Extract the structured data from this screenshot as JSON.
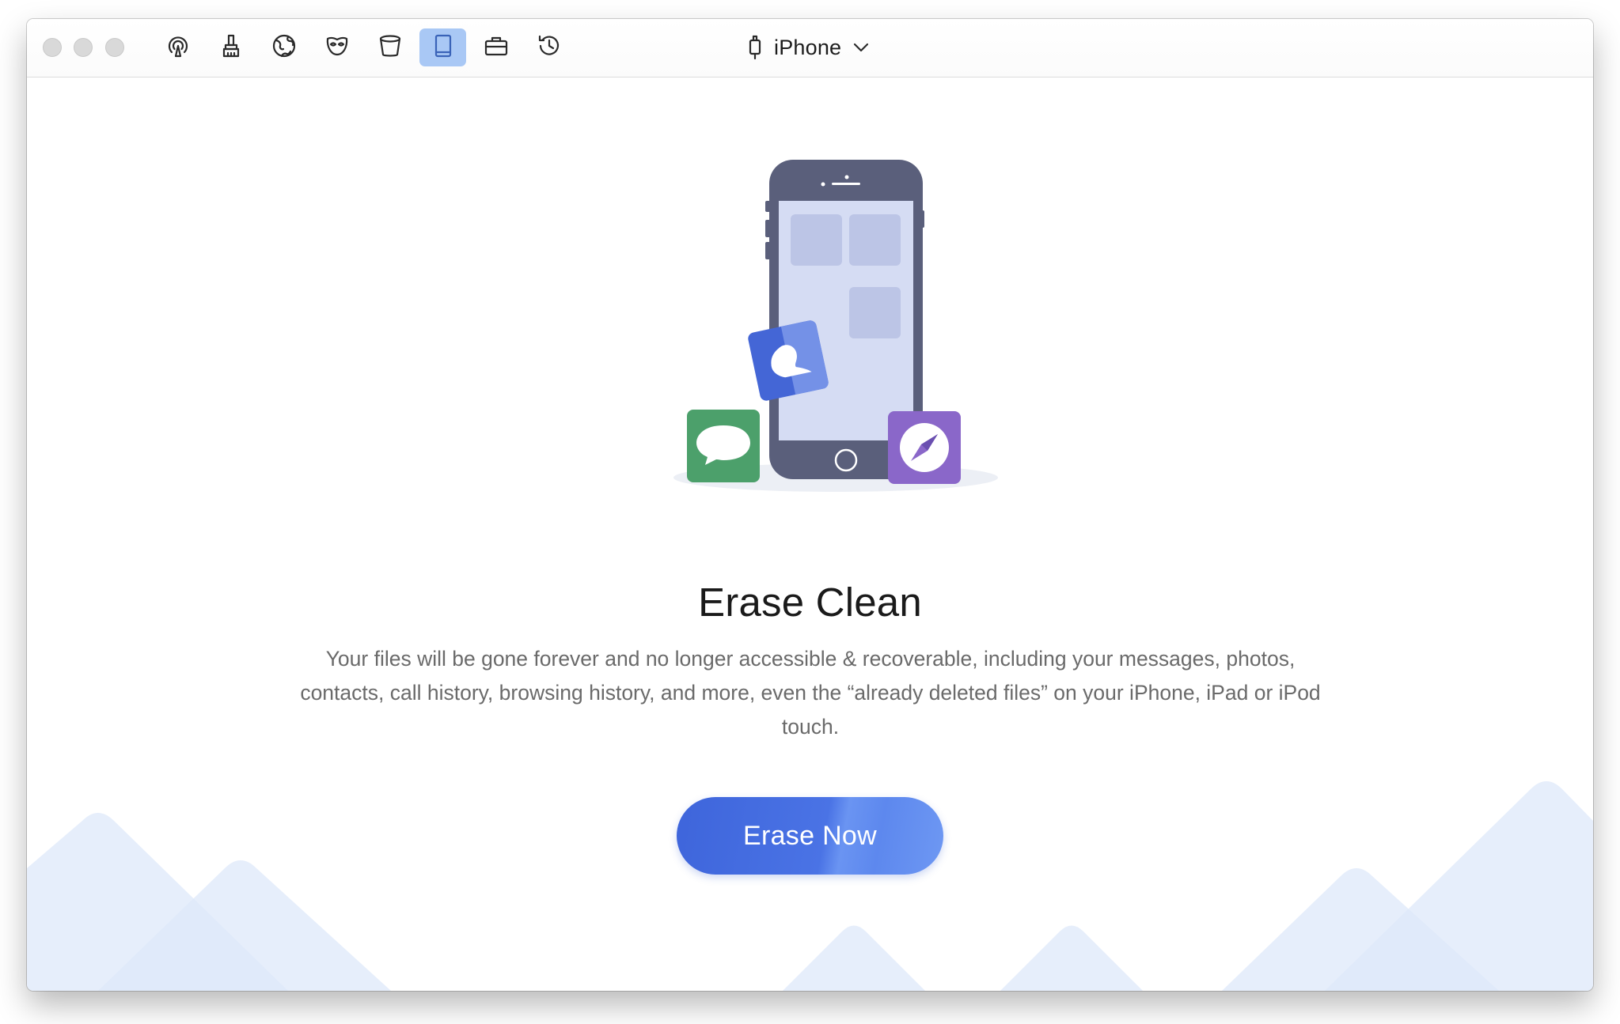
{
  "window": {
    "traffic_lights": [
      "close",
      "minimize",
      "zoom"
    ]
  },
  "toolbar": {
    "tools": [
      {
        "name": "airdrop-icon",
        "active": false
      },
      {
        "name": "brush-icon",
        "active": false
      },
      {
        "name": "globe-icon",
        "active": false
      },
      {
        "name": "mask-icon",
        "active": false
      },
      {
        "name": "trash-bin-icon",
        "active": false
      },
      {
        "name": "tablet-icon",
        "active": true
      },
      {
        "name": "briefcase-icon",
        "active": false
      },
      {
        "name": "history-clock-icon",
        "active": false
      }
    ],
    "device": {
      "icon": "device-connector-icon",
      "name": "iPhone",
      "chevron": "chevron-down-icon"
    }
  },
  "main": {
    "title": "Erase Clean",
    "description": "Your files will be gone forever and no longer accessible & recoverable, including your messages, photos, contacts, call history, browsing history, and more, even the “already deleted files” on your iPhone, iPad or iPod touch.",
    "button_label": "Erase Now"
  },
  "colors": {
    "accent": "#4a73e5",
    "active_tool_bg": "#a9c8f5",
    "mountain": "#dde8fa",
    "phone_body": "#5a5f7b",
    "phone_screen": "#d5dcf3",
    "messages_app": "#4ca06b",
    "safari_app": "#8a67c9",
    "contacts_app": "#4466d6"
  }
}
